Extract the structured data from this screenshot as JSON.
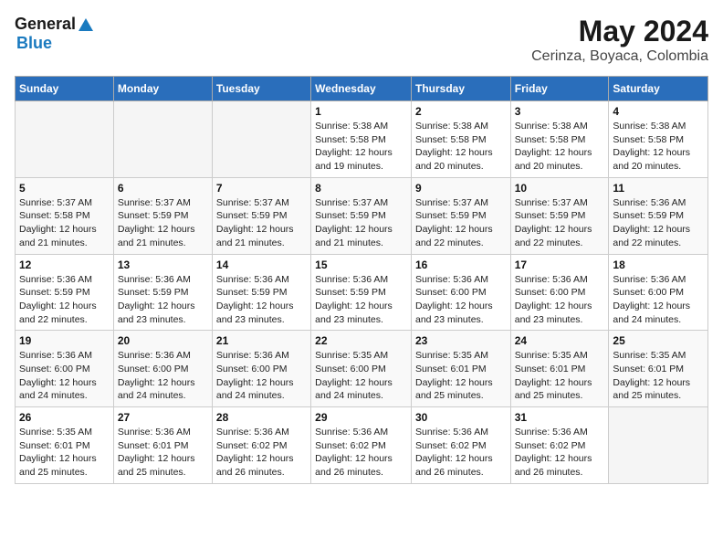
{
  "logo": {
    "general": "General",
    "blue": "Blue"
  },
  "title": "May 2024",
  "subtitle": "Cerinza, Boyaca, Colombia",
  "days_of_week": [
    "Sunday",
    "Monday",
    "Tuesday",
    "Wednesday",
    "Thursday",
    "Friday",
    "Saturday"
  ],
  "weeks": [
    [
      {
        "day": "",
        "info": ""
      },
      {
        "day": "",
        "info": ""
      },
      {
        "day": "",
        "info": ""
      },
      {
        "day": "1",
        "info": "Sunrise: 5:38 AM\nSunset: 5:58 PM\nDaylight: 12 hours and 19 minutes."
      },
      {
        "day": "2",
        "info": "Sunrise: 5:38 AM\nSunset: 5:58 PM\nDaylight: 12 hours and 20 minutes."
      },
      {
        "day": "3",
        "info": "Sunrise: 5:38 AM\nSunset: 5:58 PM\nDaylight: 12 hours and 20 minutes."
      },
      {
        "day": "4",
        "info": "Sunrise: 5:38 AM\nSunset: 5:58 PM\nDaylight: 12 hours and 20 minutes."
      }
    ],
    [
      {
        "day": "5",
        "info": "Sunrise: 5:37 AM\nSunset: 5:58 PM\nDaylight: 12 hours and 21 minutes."
      },
      {
        "day": "6",
        "info": "Sunrise: 5:37 AM\nSunset: 5:59 PM\nDaylight: 12 hours and 21 minutes."
      },
      {
        "day": "7",
        "info": "Sunrise: 5:37 AM\nSunset: 5:59 PM\nDaylight: 12 hours and 21 minutes."
      },
      {
        "day": "8",
        "info": "Sunrise: 5:37 AM\nSunset: 5:59 PM\nDaylight: 12 hours and 21 minutes."
      },
      {
        "day": "9",
        "info": "Sunrise: 5:37 AM\nSunset: 5:59 PM\nDaylight: 12 hours and 22 minutes."
      },
      {
        "day": "10",
        "info": "Sunrise: 5:37 AM\nSunset: 5:59 PM\nDaylight: 12 hours and 22 minutes."
      },
      {
        "day": "11",
        "info": "Sunrise: 5:36 AM\nSunset: 5:59 PM\nDaylight: 12 hours and 22 minutes."
      }
    ],
    [
      {
        "day": "12",
        "info": "Sunrise: 5:36 AM\nSunset: 5:59 PM\nDaylight: 12 hours and 22 minutes."
      },
      {
        "day": "13",
        "info": "Sunrise: 5:36 AM\nSunset: 5:59 PM\nDaylight: 12 hours and 23 minutes."
      },
      {
        "day": "14",
        "info": "Sunrise: 5:36 AM\nSunset: 5:59 PM\nDaylight: 12 hours and 23 minutes."
      },
      {
        "day": "15",
        "info": "Sunrise: 5:36 AM\nSunset: 5:59 PM\nDaylight: 12 hours and 23 minutes."
      },
      {
        "day": "16",
        "info": "Sunrise: 5:36 AM\nSunset: 6:00 PM\nDaylight: 12 hours and 23 minutes."
      },
      {
        "day": "17",
        "info": "Sunrise: 5:36 AM\nSunset: 6:00 PM\nDaylight: 12 hours and 23 minutes."
      },
      {
        "day": "18",
        "info": "Sunrise: 5:36 AM\nSunset: 6:00 PM\nDaylight: 12 hours and 24 minutes."
      }
    ],
    [
      {
        "day": "19",
        "info": "Sunrise: 5:36 AM\nSunset: 6:00 PM\nDaylight: 12 hours and 24 minutes."
      },
      {
        "day": "20",
        "info": "Sunrise: 5:36 AM\nSunset: 6:00 PM\nDaylight: 12 hours and 24 minutes."
      },
      {
        "day": "21",
        "info": "Sunrise: 5:36 AM\nSunset: 6:00 PM\nDaylight: 12 hours and 24 minutes."
      },
      {
        "day": "22",
        "info": "Sunrise: 5:35 AM\nSunset: 6:00 PM\nDaylight: 12 hours and 24 minutes."
      },
      {
        "day": "23",
        "info": "Sunrise: 5:35 AM\nSunset: 6:01 PM\nDaylight: 12 hours and 25 minutes."
      },
      {
        "day": "24",
        "info": "Sunrise: 5:35 AM\nSunset: 6:01 PM\nDaylight: 12 hours and 25 minutes."
      },
      {
        "day": "25",
        "info": "Sunrise: 5:35 AM\nSunset: 6:01 PM\nDaylight: 12 hours and 25 minutes."
      }
    ],
    [
      {
        "day": "26",
        "info": "Sunrise: 5:35 AM\nSunset: 6:01 PM\nDaylight: 12 hours and 25 minutes."
      },
      {
        "day": "27",
        "info": "Sunrise: 5:36 AM\nSunset: 6:01 PM\nDaylight: 12 hours and 25 minutes."
      },
      {
        "day": "28",
        "info": "Sunrise: 5:36 AM\nSunset: 6:02 PM\nDaylight: 12 hours and 26 minutes."
      },
      {
        "day": "29",
        "info": "Sunrise: 5:36 AM\nSunset: 6:02 PM\nDaylight: 12 hours and 26 minutes."
      },
      {
        "day": "30",
        "info": "Sunrise: 5:36 AM\nSunset: 6:02 PM\nDaylight: 12 hours and 26 minutes."
      },
      {
        "day": "31",
        "info": "Sunrise: 5:36 AM\nSunset: 6:02 PM\nDaylight: 12 hours and 26 minutes."
      },
      {
        "day": "",
        "info": ""
      }
    ]
  ]
}
